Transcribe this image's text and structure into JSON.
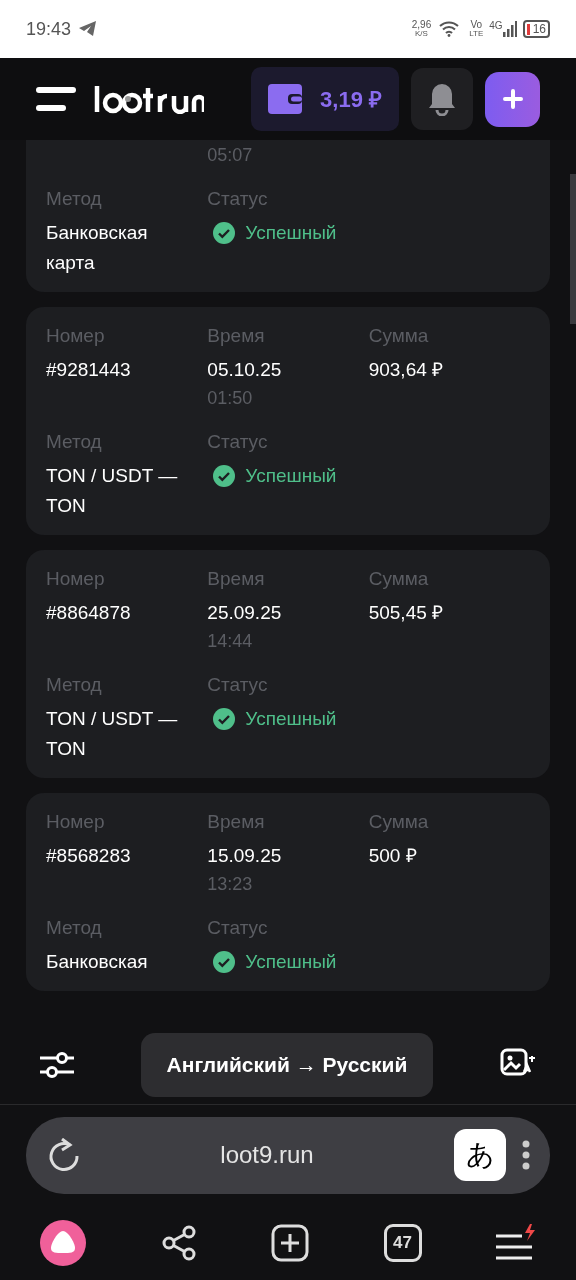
{
  "status_bar": {
    "time": "19:43",
    "speed": "2,96",
    "speed_unit": "K/S",
    "volte_top": "Vo",
    "volte_bottom": "LTE",
    "network": "4G",
    "battery": "16"
  },
  "header": {
    "balance": "3,19 ₽"
  },
  "transactions": [
    {
      "cut_top": true,
      "time_sub": "05:07",
      "method_label": "Метод",
      "method": "Банковская карта",
      "status_label": "Статус",
      "status": "Успешный",
      "color": "#4fbf8a"
    },
    {
      "cut_top": false,
      "number_label": "Номер",
      "number": "#9281443",
      "time_label": "Время",
      "time": "05.10.25",
      "time_sub": "01:50",
      "amount_label": "Сумма",
      "amount": "903,64 ₽",
      "method_label": "Метод",
      "method": "TON / USDT — TON",
      "status_label": "Статус",
      "status": "Успешный",
      "color": "#4fbf8a"
    },
    {
      "cut_top": false,
      "number_label": "Номер",
      "number": "#8864878",
      "time_label": "Время",
      "time": "25.09.25",
      "time_sub": "14:44",
      "amount_label": "Сумма",
      "amount": "505,45 ₽",
      "method_label": "Метод",
      "method": "TON / USDT — TON",
      "status_label": "Статус",
      "status": "Успешный",
      "color": "#4fbf8a"
    },
    {
      "cut_top": false,
      "number_label": "Номер",
      "number": "#8568283",
      "time_label": "Время",
      "time": "15.09.25",
      "time_sub": "13:23",
      "amount_label": "Сумма",
      "amount": "500 ₽",
      "method_label": "Метод",
      "method": "Банковская",
      "status_label": "Статус",
      "status": "Успешный",
      "color": "#4fbf8a"
    }
  ],
  "translate_bar": {
    "label": "Английский → Русский"
  },
  "address_bar": {
    "url": "loot9.run",
    "translate_glyph": "あ"
  },
  "bottom_nav": {
    "tabs_count": "47"
  }
}
